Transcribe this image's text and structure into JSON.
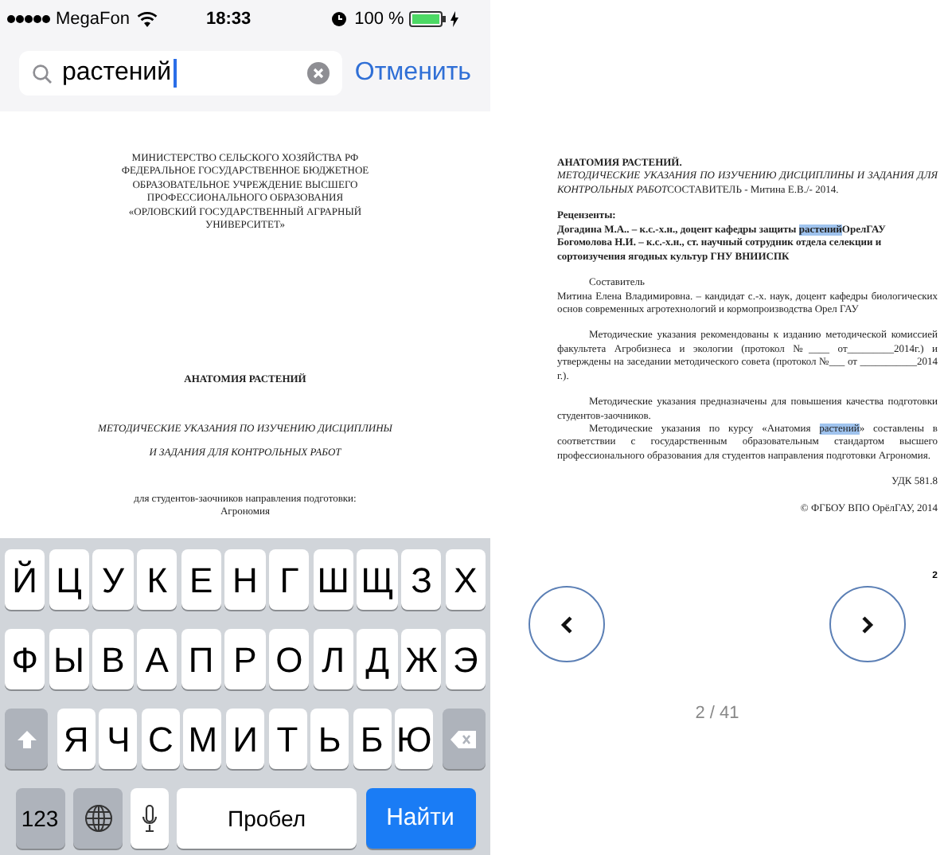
{
  "status_bar": {
    "carrier": "MegaFon",
    "time": "18:33",
    "battery": "100 %"
  },
  "search": {
    "value": "растений",
    "cancel": "Отменить"
  },
  "document_left": [
    {
      "kind": "plain",
      "text": "МИНИСТЕРСТВО СЕЛЬСКОГО ХОЗЯЙСТВА   РФ\nФЕДЕРАЛЬНОЕ ГОСУДАРСТВЕННОЕ БЮДЖЕТНОЕ\nОБРАЗОВАТЕЛЬНОЕ УЧРЕЖДЕНИЕ ВЫСШЕГО\nПРОФЕССИОНАЛЬНОГО ОБРАЗОВАНИЯ\n«ОРЛОВСКИЙ ГОСУДАРСТВЕННЫЙ АГРАРНЫЙ\nУНИВЕРСИТЕТ»"
    },
    {
      "kind": "bold",
      "text": "АНАТОМИЯ РАСТЕНИЙ"
    },
    {
      "kind": "italic",
      "text": "МЕТОДИЧЕСКИЕ УКАЗАНИЯ ПО ИЗУЧЕНИЮ ДИСЦИПЛИНЫ\nИ ЗАДАНИЯ ДЛЯ КОНТРОЛЬНЫХ РАБОТ"
    },
    {
      "kind": "plain",
      "text": "для студентов-заочников направления подготовки:\nАгрономия"
    }
  ],
  "keyboard": [
    [
      {
        "kind": "letter",
        "label": "Й"
      },
      {
        "kind": "letter",
        "label": "Ц"
      },
      {
        "kind": "letter",
        "label": "У"
      },
      {
        "kind": "letter",
        "label": "К"
      },
      {
        "kind": "letter",
        "label": "Е"
      },
      {
        "kind": "letter",
        "label": "Н"
      },
      {
        "kind": "letter",
        "label": "Г"
      },
      {
        "kind": "letter",
        "label": "Ш"
      },
      {
        "kind": "letter",
        "label": "Щ"
      },
      {
        "kind": "letter",
        "label": "З"
      },
      {
        "kind": "letter",
        "label": "Х"
      }
    ],
    [
      {
        "kind": "letter",
        "label": "Ф"
      },
      {
        "kind": "letter",
        "label": "Ы"
      },
      {
        "kind": "letter",
        "label": "В"
      },
      {
        "kind": "letter",
        "label": "А"
      },
      {
        "kind": "letter",
        "label": "П"
      },
      {
        "kind": "letter",
        "label": "Р"
      },
      {
        "kind": "letter",
        "label": "О"
      },
      {
        "kind": "letter",
        "label": "Л"
      },
      {
        "kind": "letter",
        "label": "Д"
      },
      {
        "kind": "letter",
        "label": "Ж"
      },
      {
        "kind": "letter",
        "label": "Э"
      }
    ],
    [
      {
        "kind": "shift"
      },
      {
        "kind": "letter",
        "label": "Я"
      },
      {
        "kind": "letter",
        "label": "Ч"
      },
      {
        "kind": "letter",
        "label": "С"
      },
      {
        "kind": "letter",
        "label": "М"
      },
      {
        "kind": "letter",
        "label": "И"
      },
      {
        "kind": "letter",
        "label": "Т"
      },
      {
        "kind": "letter",
        "label": "Ь"
      },
      {
        "kind": "letter",
        "label": "Б"
      },
      {
        "kind": "letter",
        "label": "Ю"
      },
      {
        "kind": "delete"
      }
    ],
    [
      {
        "kind": "mode",
        "label": "123"
      },
      {
        "kind": "globe"
      },
      {
        "kind": "mic"
      },
      {
        "kind": "space",
        "label": "Пробел"
      },
      {
        "kind": "action",
        "label": "Найти"
      }
    ]
  ],
  "document_right": [
    [
      {
        "kind": "bold",
        "segments": [
          {
            "text": "АНАТОМИЯ РАСТЕНИЙ.",
            "highlighted": false
          }
        ]
      },
      {
        "kind": "plain",
        "segments": [
          {
            "text": "МЕТОДИЧЕСКИЕ УКАЗАНИЯ ПО ИЗУЧЕНИЮ ДИСЦИПЛИНЫ И ЗАДАНИЯ ДЛЯ КОНТРОЛЬНЫХ РАБОТ",
            "highlighted": false,
            "italic": true
          },
          {
            "text": "СОСТАВИТЕЛЬ - Митина Е.В./- 2014.",
            "highlighted": false,
            "italic": false
          }
        ]
      }
    ],
    [
      {
        "kind": "bold",
        "segments": [
          {
            "text": "Рецензенты:",
            "highlighted": false
          }
        ]
      },
      {
        "kind": "bold",
        "segments": [
          {
            "text": "Догадина М.А.. – к.с.-х.н., доцент кафедры защиты ",
            "highlighted": false
          },
          {
            "text": "растений",
            "highlighted": true
          },
          {
            "text": "ОрелГАУ",
            "highlighted": false
          }
        ]
      },
      {
        "kind": "bold",
        "segments": [
          {
            "text": "Богомолова Н.И. – к.с.-х.н.,  ст. научный сотрудник отдела селекции и сортоизучения ягодных культур  ГНУ ВНИИСПК",
            "highlighted": false
          }
        ]
      }
    ],
    [
      {
        "kind": "indent",
        "segments": [
          {
            "text": "Составитель",
            "highlighted": false
          }
        ]
      },
      {
        "kind": "plain",
        "segments": [
          {
            "text": "Митина Елена Владимировна.  –  кандидат с.-х. наук, доцент кафедры биологических основ современных агротехнологий и кормопроизводства Орел ГАУ",
            "highlighted": false
          }
        ]
      }
    ],
    [
      {
        "kind": "indent",
        "segments": [
          {
            "text": "Методические указания рекомендованы к изданию методической комиссией факультета Агробизнеса и экологии (протокол №____ от_________2014г.) и утверждены на заседании методического совета (протокол №___ от ___________2014 г.).",
            "highlighted": false
          }
        ]
      }
    ],
    [
      {
        "kind": "indent",
        "segments": [
          {
            "text": "Методические указания предназначены для повышения качества подготовки студентов-заочников.",
            "highlighted": false
          }
        ]
      },
      {
        "kind": "indent",
        "segments": [
          {
            "text": "Методические указания по курсу «Анатомия ",
            "highlighted": false
          },
          {
            "text": "растений",
            "highlighted": true
          },
          {
            "text": "» составлены в соответствии с государственным образовательным стандартом высшего профессионального образования для студентов направления подготовки   Агрономия.",
            "highlighted": false
          }
        ]
      }
    ],
    [
      {
        "kind": "right",
        "segments": [
          {
            "text": "УДК 581.8",
            "highlighted": false
          }
        ]
      }
    ],
    [
      {
        "kind": "right",
        "segments": [
          {
            "text": "© ФГБОУ ВПО ОрёлГАУ, 2014",
            "highlighted": false
          }
        ]
      }
    ]
  ],
  "page_mark": "2",
  "page_counter": "2 / 41"
}
